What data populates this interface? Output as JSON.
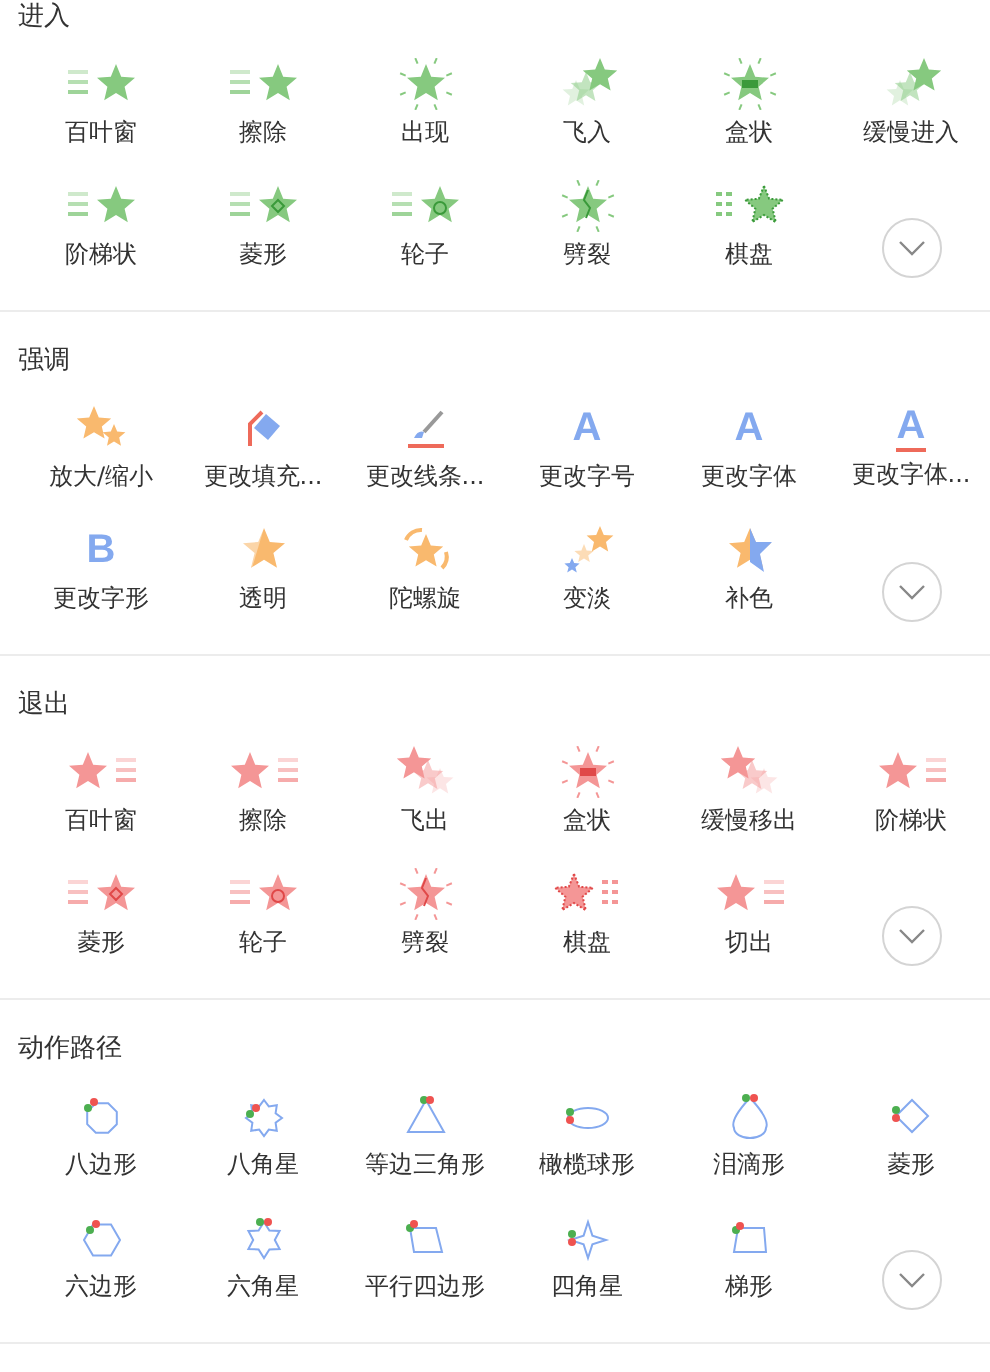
{
  "sections": [
    {
      "kind": "entrance",
      "title": "进入",
      "items": [
        {
          "label": "百叶窗"
        },
        {
          "label": "擦除"
        },
        {
          "label": "出现"
        },
        {
          "label": "飞入"
        },
        {
          "label": "盒状"
        },
        {
          "label": "缓慢进入"
        },
        {
          "label": "阶梯状"
        },
        {
          "label": "菱形"
        },
        {
          "label": "轮子"
        },
        {
          "label": "劈裂"
        },
        {
          "label": "棋盘"
        }
      ]
    },
    {
      "kind": "emphasis",
      "title": "强调",
      "items": [
        {
          "label": "放大/缩小"
        },
        {
          "label": "更改填充..."
        },
        {
          "label": "更改线条..."
        },
        {
          "label": "更改字号",
          "glyph": "A"
        },
        {
          "label": "更改字体",
          "glyph": "A"
        },
        {
          "label": "更改字体...",
          "glyph": "A"
        },
        {
          "label": "更改字形",
          "glyph": "B"
        },
        {
          "label": "透明"
        },
        {
          "label": "陀螺旋"
        },
        {
          "label": "变淡"
        },
        {
          "label": "补色"
        }
      ]
    },
    {
      "kind": "exit",
      "title": "退出",
      "items": [
        {
          "label": "百叶窗"
        },
        {
          "label": "擦除"
        },
        {
          "label": "飞出"
        },
        {
          "label": "盒状"
        },
        {
          "label": "缓慢移出"
        },
        {
          "label": "阶梯状"
        },
        {
          "label": "菱形"
        },
        {
          "label": "轮子"
        },
        {
          "label": "劈裂"
        },
        {
          "label": "棋盘"
        },
        {
          "label": "切出"
        }
      ]
    },
    {
      "kind": "path",
      "title": "动作路径",
      "items": [
        {
          "label": "八边形"
        },
        {
          "label": "八角星"
        },
        {
          "label": "等边三角形"
        },
        {
          "label": "橄榄球形"
        },
        {
          "label": "泪滴形"
        },
        {
          "label": "菱形"
        },
        {
          "label": "六边形"
        },
        {
          "label": "六角星"
        },
        {
          "label": "平行四边形"
        },
        {
          "label": "四角星"
        },
        {
          "label": "梯形"
        }
      ]
    }
  ]
}
